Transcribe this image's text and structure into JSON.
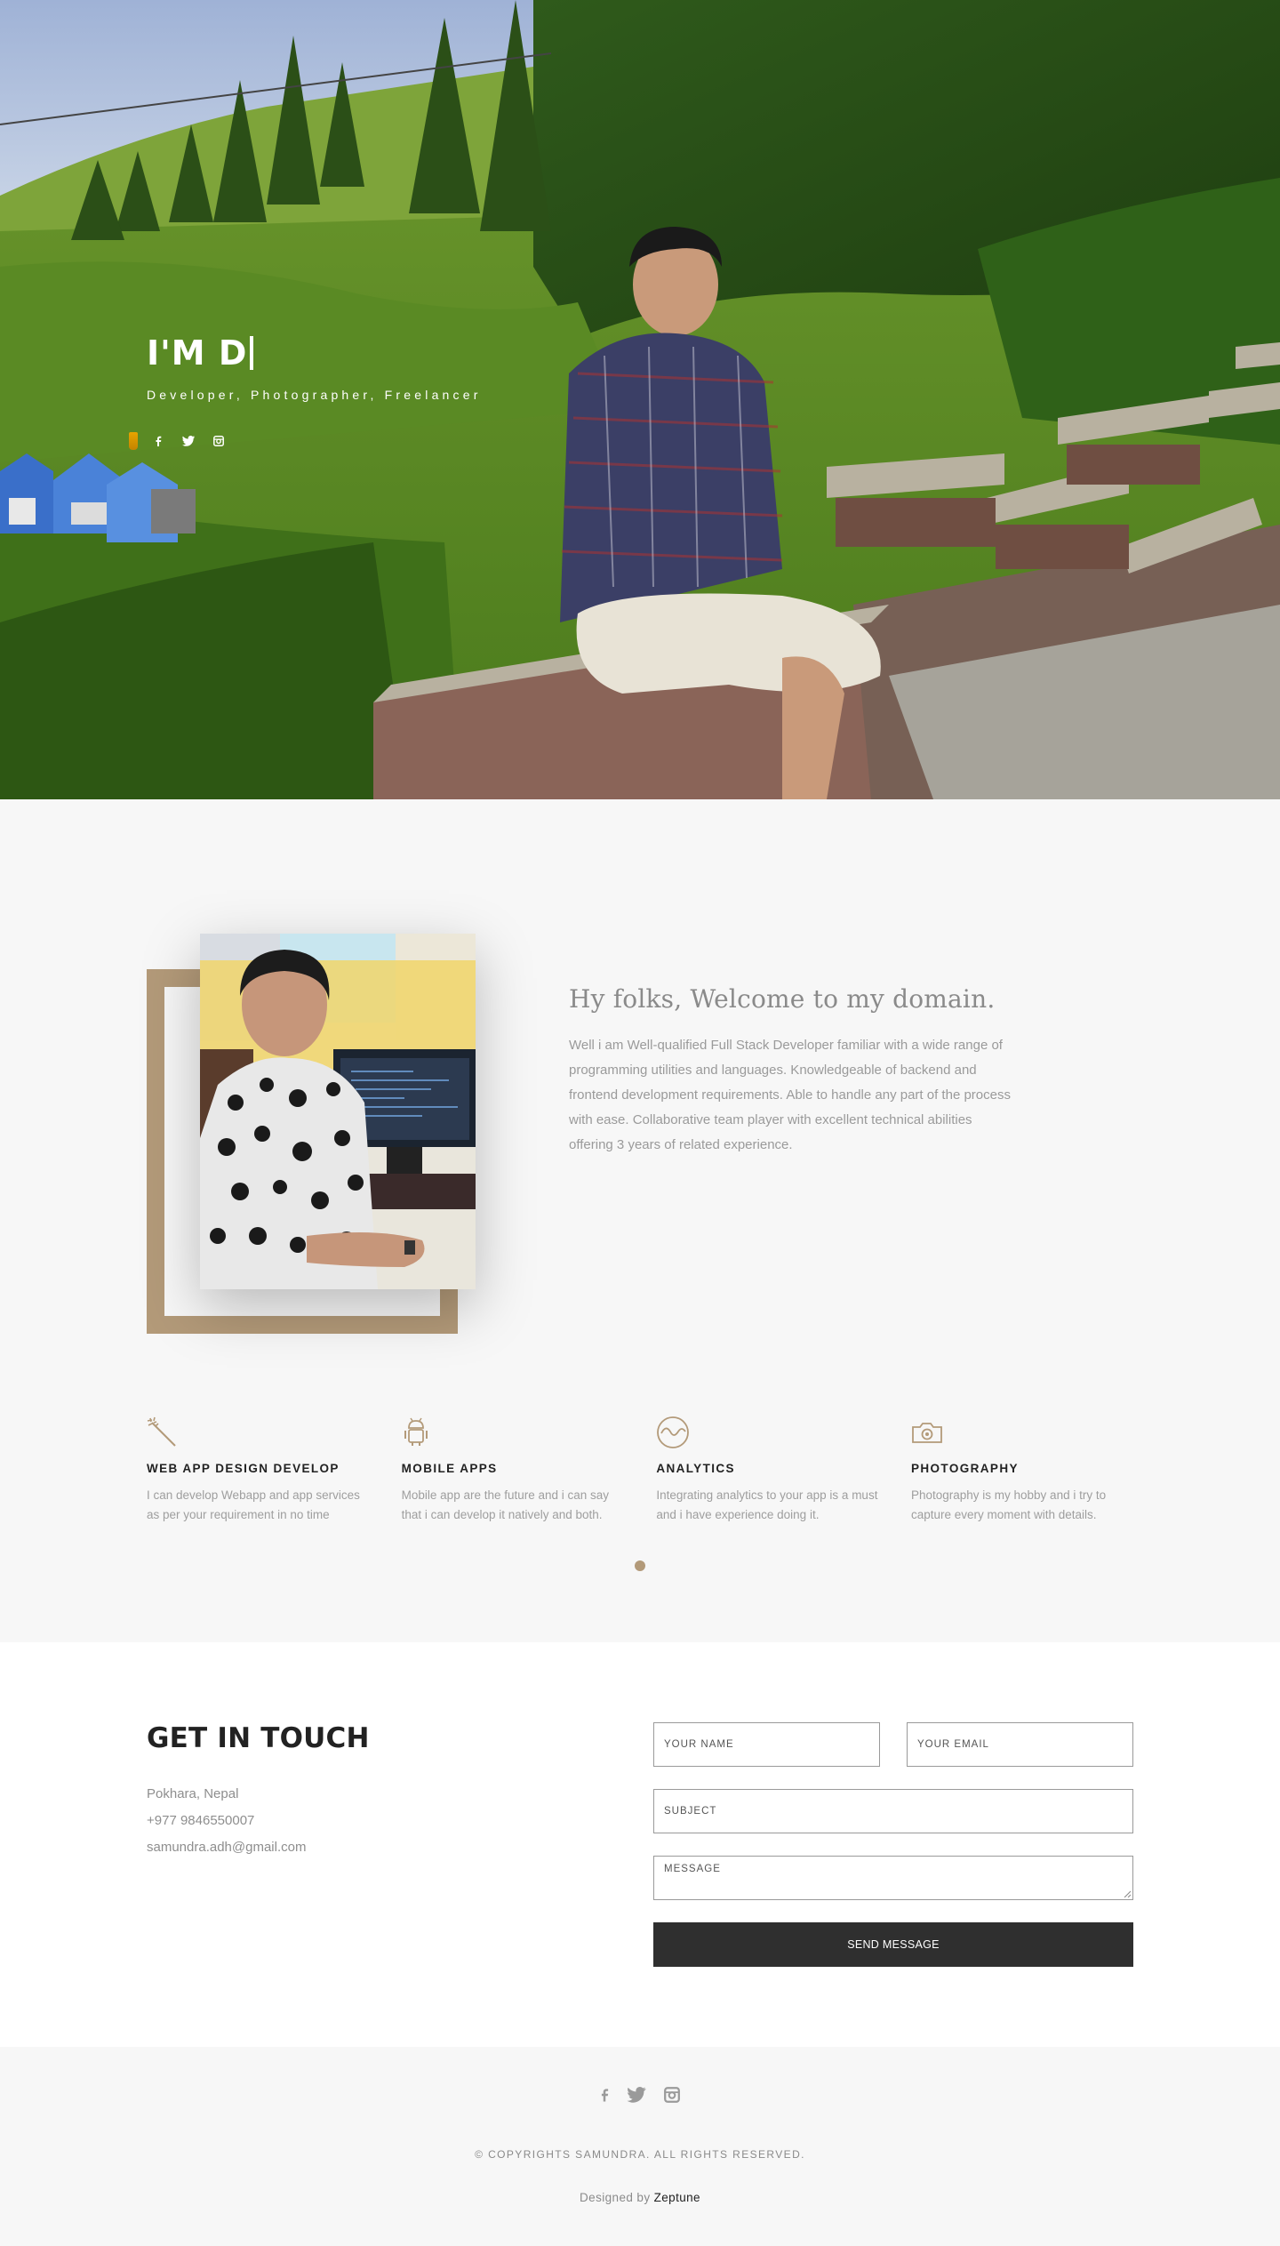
{
  "hero": {
    "title": "I'M D",
    "subtitle": "Developer, Photographer, Freelancer",
    "social_icons": [
      "coffee-cup-icon",
      "facebook-icon",
      "twitter-icon",
      "instagram-icon"
    ]
  },
  "about": {
    "title": "Hy folks, Welcome to my domain.",
    "body": "Well i am Well-qualified Full Stack Developer familiar with a wide range of programming utilities and languages. Knowledgeable of backend and frontend development requirements. Able to handle any part of the process with ease. Collaborative team player with excellent technical abilities offering 3 years of related experience.",
    "accent_color": "#b39a79"
  },
  "services": [
    {
      "icon": "magic-wand-icon",
      "title": "WEB APP DESIGN DEVELOP",
      "desc": "I can develop Webapp and app services as per your requirement in no time"
    },
    {
      "icon": "android-icon",
      "title": "MOBILE APPS",
      "desc": "Mobile app are the future and i can say that i can develop it natively and both."
    },
    {
      "icon": "analytics-wave-icon",
      "title": "ANALYTICS",
      "desc": "Integrating analytics to your app is a must and i have experience doing it."
    },
    {
      "icon": "camera-icon",
      "title": "PHOTOGRAPHY",
      "desc": "Photography is my hobby and i try to capture every moment with details."
    }
  ],
  "contact": {
    "title": "GET IN TOUCH",
    "location": "Pokhara, Nepal",
    "phone": "+977 9846550007",
    "email": "samundra.adh@gmail.com",
    "name_placeholder": "YOUR NAME",
    "email_placeholder": "YOUR EMAIL",
    "subject_placeholder": "SUBJECT",
    "message_placeholder": "MESSAGE",
    "send_label": "SEND MESSAGE"
  },
  "footer": {
    "social_icons": [
      "facebook-icon",
      "twitter-icon",
      "instagram-icon"
    ],
    "copyright": "© COPYRIGHTS SAMUNDRA. ALL RIGHTS RESERVED.",
    "designed_prefix": "Designed by",
    "designed_brand": "Zeptune"
  }
}
